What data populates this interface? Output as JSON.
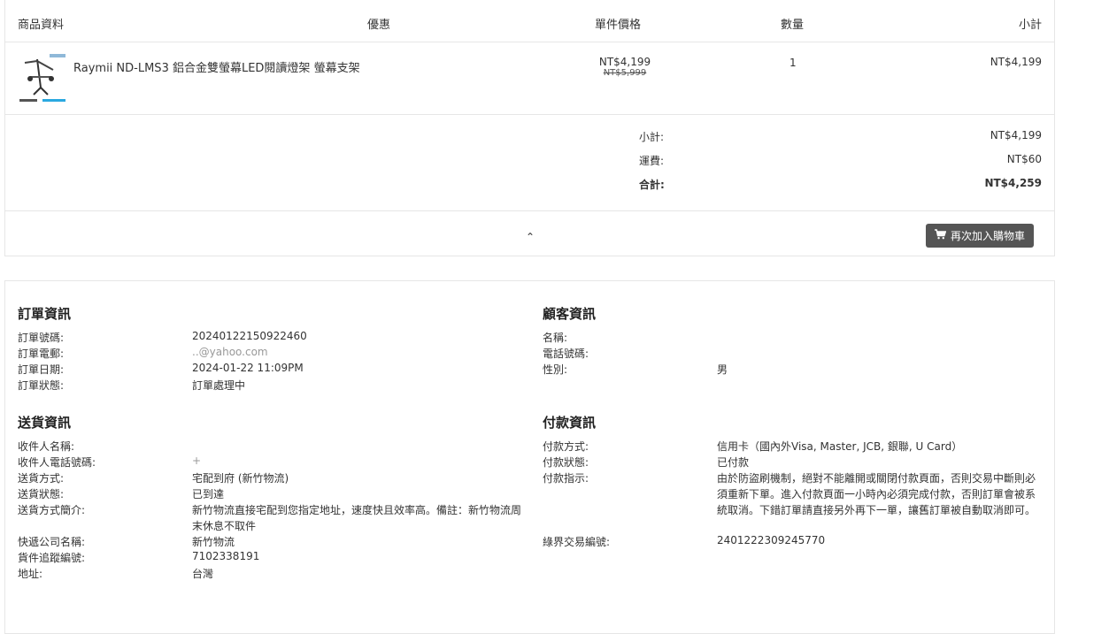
{
  "cart": {
    "headers": {
      "product": "商品資料",
      "discount": "優惠",
      "unit_price": "單件價格",
      "quantity": "數量",
      "subtotal": "小計"
    },
    "item": {
      "name": "Raymii ND-LMS3 鋁合金雙螢幕LED閱讀燈架 螢幕支架",
      "price": "NT$4,199",
      "original_price": "NT$5,999",
      "quantity": "1",
      "subtotal": "NT$4,199"
    },
    "summary": {
      "subtotal_label": "小計:",
      "subtotal_value": "NT$4,199",
      "shipping_label": "運費:",
      "shipping_value": "NT$60",
      "total_label": "合計:",
      "total_value": "NT$4,259"
    },
    "collapse_icon": "chevron-up-icon",
    "rebuy_label": "再次加入購物車",
    "rebuy_icon": "cart-icon",
    "button_color": "#555555"
  },
  "order_info": {
    "title": "訂單資訊",
    "number_label": "訂單號碼:",
    "number_value": "20240122150922460",
    "email_label": "訂單電郵:",
    "email_value": "..@yahoo.com",
    "date_label": "訂單日期:",
    "date_value": "2024-01-22 11:09PM",
    "status_label": "訂單狀態:",
    "status_value": "訂單處理中"
  },
  "customer_info": {
    "title": "顧客資訊",
    "name_label": "名稱:",
    "name_value": "",
    "phone_label": "電話號碼:",
    "phone_value": "",
    "gender_label": "性別:",
    "gender_value": "男"
  },
  "delivery_info": {
    "title": "送貨資訊",
    "recipient_label": "收件人名稱:",
    "recipient_value": "",
    "recipient_phone_label": "收件人電話號碼:",
    "recipient_phone_value": "+",
    "method_label": "送貨方式:",
    "method_value": "宅配到府 (新竹物流)",
    "status_label": "送貨狀態:",
    "status_value": "已到達",
    "desc_label": "送貨方式簡介:",
    "desc_value": "新竹物流直接宅配到您指定地址，速度快且效率高。備註：新竹物流周末休息不取件",
    "courier_label": "快遞公司名稱:",
    "courier_value": "新竹物流",
    "tracking_label": "貨件追蹤編號:",
    "tracking_value": "7102338191",
    "address_label": "地址:",
    "address_value": "台灣"
  },
  "payment_info": {
    "title": "付款資訊",
    "method_label": "付款方式:",
    "method_value": "信用卡（國內外Visa, Master, JCB, 銀聯, U Card）",
    "status_label": "付款狀態:",
    "status_value": "已付款",
    "instruction_label": "付款指示:",
    "instruction_value": "由於防盜刷機制，絕對不能離開或關閉付款頁面，否則交易中斷則必須重新下單。進入付款頁面一小時內必須完成付款，否則訂單會被系統取消。下錯訂單請直接另外再下一單，讓舊訂單被自動取消即可。",
    "txn_label": "綠界交易編號:",
    "txn_value": "2401222309245770"
  }
}
